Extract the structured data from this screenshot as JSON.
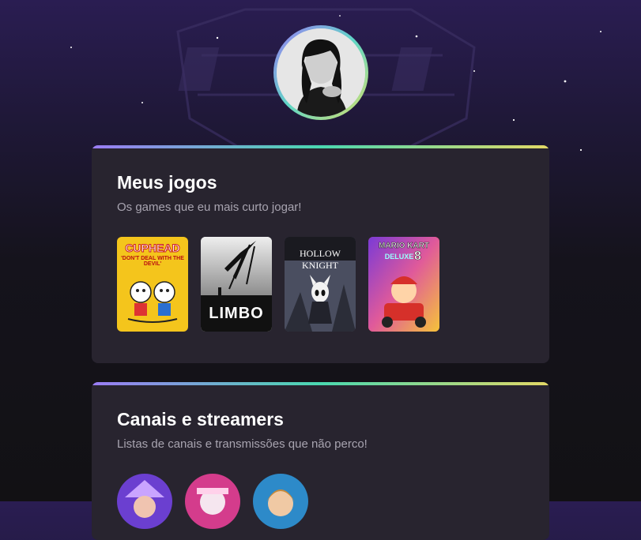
{
  "profile": {
    "avatar_name": "profile-photo"
  },
  "games_section": {
    "title": "Meus jogos",
    "subtitle": "Os games que eu mais curto jogar!",
    "games": [
      {
        "title": "CUPHEAD",
        "tagline": "'DON'T DEAL WITH THE DEVIL'",
        "color": "#f4c51c"
      },
      {
        "title": "LIMBO",
        "color": "#111111"
      },
      {
        "title": "HOLLOW KNIGHT",
        "color": "#3a3c4a"
      },
      {
        "title": "MARIO KART",
        "subtitle": "DELUXE",
        "number": "8",
        "color": "#e94a3a"
      }
    ]
  },
  "channels_section": {
    "title": "Canais e streamers",
    "subtitle": "Listas de canais e transmissões que não perco!"
  },
  "colors": {
    "accent_gradient": [
      "#9b7cf5",
      "#4ad9b0",
      "#e3d866"
    ],
    "card_bg": "#28242f",
    "text_primary": "#ffffff",
    "text_secondary": "#a8a4b0"
  }
}
